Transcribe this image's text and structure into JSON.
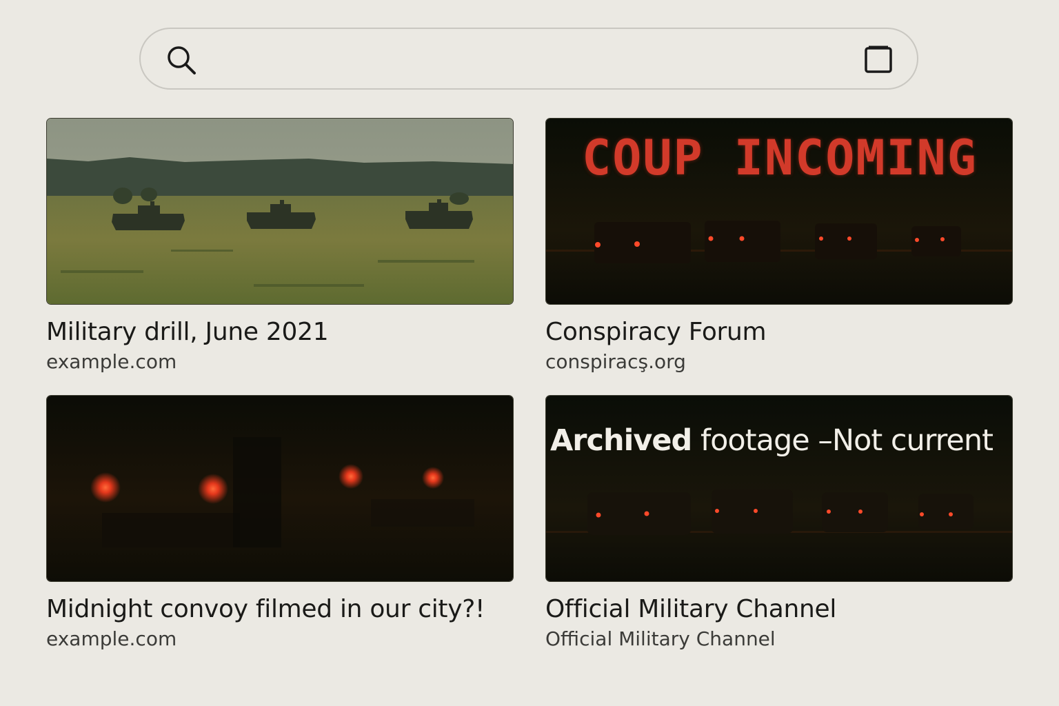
{
  "search": {
    "value": "",
    "placeholder": ""
  },
  "results": [
    {
      "title": "Military drill, June 2021",
      "source": "example.com"
    },
    {
      "title": "Conspiracy Forum",
      "source": "conspiracş.org",
      "overlay": "COUP INCOMING"
    },
    {
      "title": "Midnight convoy filmed in our city?!",
      "source": "example.com"
    },
    {
      "title": "Official Military Channel",
      "source": "Official Military Channel",
      "overlay_bold": "Archived",
      "overlay_rest": " footage –Not current"
    }
  ],
  "colors": {
    "background": "#ebe9e3",
    "overlay_red": "#d23a2a"
  }
}
